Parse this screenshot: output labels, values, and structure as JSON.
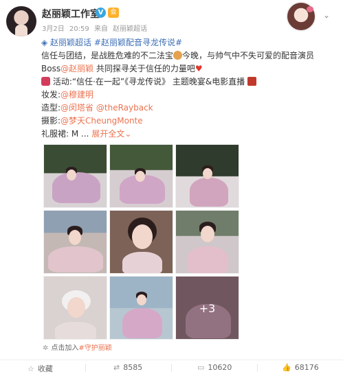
{
  "post": {
    "author": "赵丽颖工作室",
    "verified_label": "V",
    "member_badge": "会",
    "date": "3月2日",
    "time": "20:59",
    "source_prefix": "来自",
    "source": "赵丽颖超话",
    "more_icon": "chevron-down-icon"
  },
  "content": {
    "topic1": "赵丽颖超话",
    "topic2": "#赵丽颖配音寻龙传说#",
    "line2": "信任与团结，是战胜危难的不二法宝",
    "line2_tail": "今晚，与帅气中不失可爱的配音演员",
    "line3_prefix": "Boss",
    "mention": "@赵丽颖",
    "line3_tail": " 共同探寻关于信任的力量吧",
    "line4": "活动:“信任·在一起”《寻龙传说》 主题晚宴&电影直播",
    "hair_label": "妆发:",
    "hair_name": "@穆建明",
    "style_label": "造型:",
    "style_name1": "@闵塔省",
    "style_name2": "@theRayback",
    "photo_label": "摄影:",
    "photo_name": "@梦天CheungMonte",
    "gown_label": "礼服裙: M ...",
    "expand": "展开全文",
    "expand_arrow": "⌄"
  },
  "images": {
    "count": 9,
    "more_label": "+3"
  },
  "super_topic": {
    "text": "点击加入",
    "link": "#守护丽颖"
  },
  "actions": {
    "favorite": "收藏",
    "repost": "8585",
    "comment": "10620",
    "like": "68176"
  }
}
